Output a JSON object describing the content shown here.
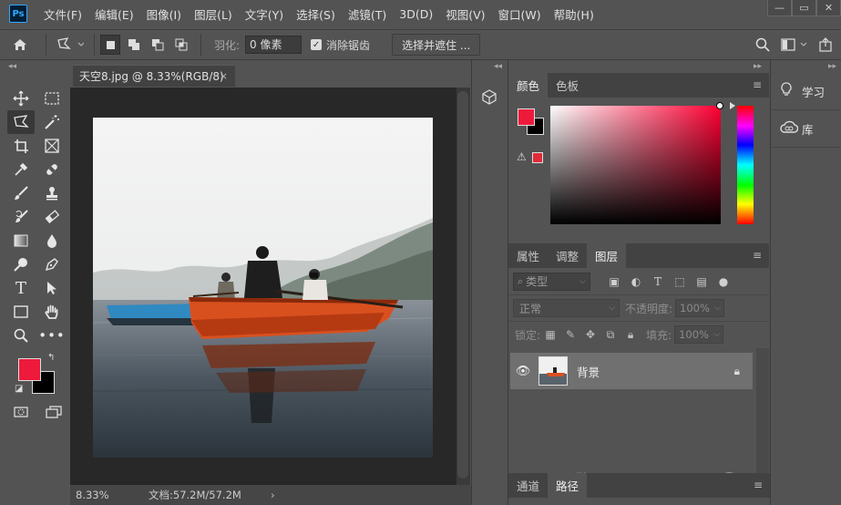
{
  "app": {
    "logo_text": "Ps"
  },
  "menu": {
    "items": [
      "文件(F)",
      "编辑(E)",
      "图像(I)",
      "图层(L)",
      "文字(Y)",
      "选择(S)",
      "滤镜(T)",
      "3D(D)",
      "视图(V)",
      "窗口(W)",
      "帮助(H)"
    ]
  },
  "window_controls": {
    "minimize": "—",
    "restore": "▭",
    "close": "✕"
  },
  "options": {
    "feather_label": "羽化:",
    "feather_value": "0 像素",
    "antialias_label": "消除锯齿",
    "antialias_checked": true,
    "select_mask_button": "选择并遮住 ..."
  },
  "toolbar": {
    "collapse": "◂◂",
    "tools": [
      "move-tool-icon",
      "marquee-tool-icon",
      "polygonal-lasso-tool-icon",
      "magic-wand-tool-icon",
      "crop-tool-icon",
      "frame-tool-icon",
      "eyedropper-tool-icon",
      "healing-brush-tool-icon",
      "brush-tool-icon",
      "stamp-tool-icon",
      "history-brush-tool-icon",
      "eraser-tool-icon",
      "gradient-tool-icon",
      "blur-tool-icon",
      "dodge-tool-icon",
      "pen-tool-icon",
      "type-tool-icon",
      "path-selection-tool-icon",
      "rectangle-tool-icon",
      "hand-tool-icon",
      "zoom-tool-icon",
      "more-tools-icon"
    ],
    "foreground_color": "#ed1a3b",
    "background_color": "#000000"
  },
  "document": {
    "tab_title": "天空8.jpg @ 8.33%(RGB/8)",
    "close": "×",
    "zoom": "8.33%",
    "doc_size": "文档:57.2M/57.2M",
    "status_arrow": "›"
  },
  "panels": {
    "collapse_left": "◂◂",
    "collapse_right": "▸▸",
    "color_tabs": [
      "颜色",
      "色板"
    ],
    "color_active_tab": "颜色",
    "panel_menu": "≡",
    "props_tabs": [
      "属性",
      "调整",
      "图层"
    ],
    "layers": {
      "kind_placeholder": "类型",
      "blend_mode": "正常",
      "opacity_label": "不透明度:",
      "opacity_value": "100%",
      "lock_label": "锁定:",
      "fill_label": "填充:",
      "fill_value": "100%",
      "layer_name": "背景"
    },
    "bottom_tabs": [
      "通道",
      "路径"
    ]
  },
  "far_right": {
    "items": [
      {
        "icon": "lightbulb-icon",
        "label": "学习"
      },
      {
        "icon": "creative-cloud-libraries-icon",
        "label": "库"
      }
    ]
  }
}
